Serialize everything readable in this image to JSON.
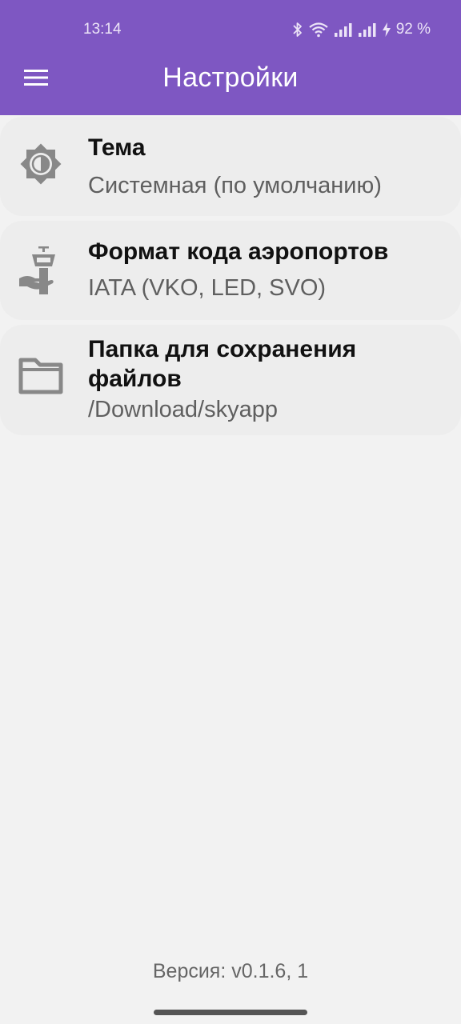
{
  "status_bar": {
    "time": "13:14",
    "battery": "92 %",
    "icons": [
      "bluetooth-icon",
      "wifi-icon",
      "signal-icon",
      "signal-icon",
      "charging-icon"
    ]
  },
  "app_bar": {
    "title": "Настройки",
    "menu_icon": "hamburger-menu-icon",
    "color": "#7e57c2"
  },
  "settings": [
    {
      "icon": "theme-brightness-icon",
      "title": "Тема",
      "value": "Системная (по умолчанию)"
    },
    {
      "icon": "airport-tower-icon",
      "title": "Формат кода аэропортов",
      "value": "IATA (VKO, LED, SVO)"
    },
    {
      "icon": "folder-icon",
      "title": "Папка для сохранения файлов",
      "value": "/Download/skyapp"
    }
  ],
  "footer": {
    "version": "Версия: v0.1.6, 1"
  }
}
